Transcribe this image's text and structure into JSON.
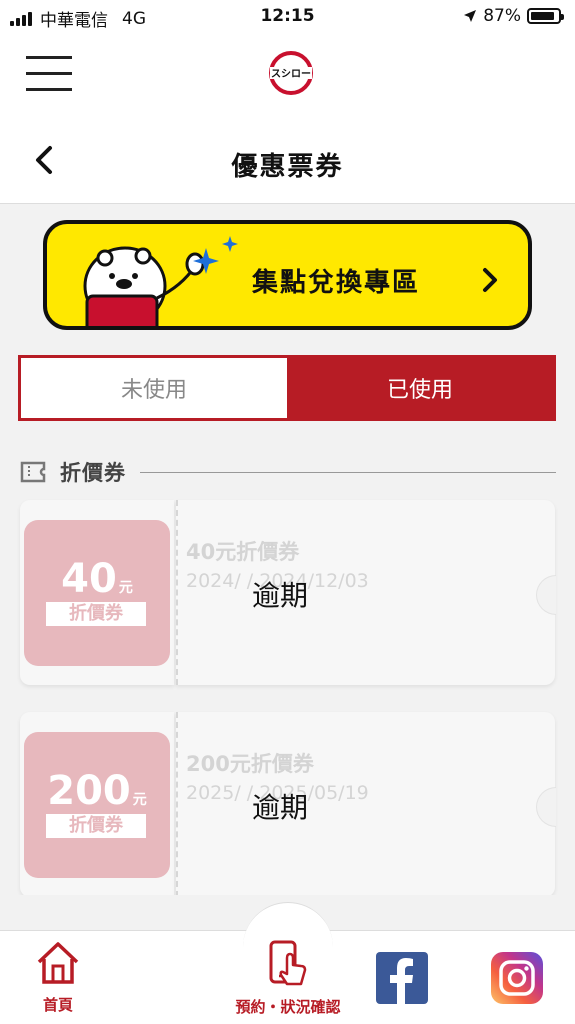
{
  "status_bar": {
    "carrier": "中華電信",
    "network": "4G",
    "time": "12:15",
    "battery": "87%",
    "battery_level": 0.87
  },
  "header": {
    "logo_text": "スシロー",
    "menu_icon": "hamburger-icon"
  },
  "titlebar": {
    "title": "優惠票券",
    "back_icon": "chevron-left-icon"
  },
  "banner": {
    "label": "集點兌換專區",
    "background": "#ffe800"
  },
  "tabs": [
    {
      "label": "未使用",
      "active": false
    },
    {
      "label": "已使用",
      "active": true
    }
  ],
  "section": {
    "label": "折價券"
  },
  "coupons": [
    {
      "amount": "40",
      "unit": "元",
      "tag": "折價券",
      "name": "40元折價券",
      "dates": "2024/    /  2024/12/03",
      "status": "逾期"
    },
    {
      "amount": "200",
      "unit": "元",
      "tag": "折價券",
      "name": "200元折價券",
      "dates": "2025/    /  2025/05/19",
      "status": "逾期"
    }
  ],
  "bottom_nav": {
    "home": "首頁",
    "reservation": "預約・狀況確認",
    "facebook_icon": "facebook-icon",
    "instagram_icon": "instagram-icon"
  },
  "colors": {
    "brand_red": "#b71c25",
    "coupon_pink": "#e7b8bd"
  }
}
